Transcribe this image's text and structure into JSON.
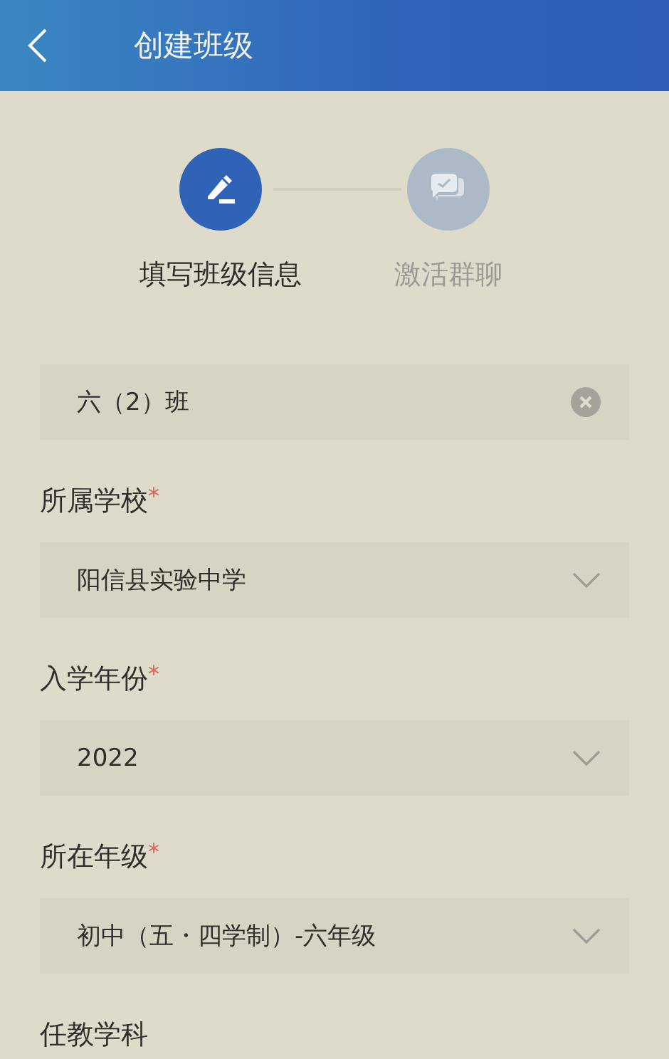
{
  "header": {
    "title": "创建班级"
  },
  "steps": [
    {
      "label": "填写班级信息",
      "selected": true
    },
    {
      "label": "激活群聊",
      "selected": false
    }
  ],
  "form": [
    {
      "kind": "text",
      "value": "六（2）班"
    },
    {
      "kind": "select",
      "label": "所属学校",
      "required_mark": "*",
      "value": "阳信县实验中学"
    },
    {
      "kind": "select",
      "label": "入学年份",
      "required_mark": "*",
      "value": "2022"
    },
    {
      "kind": "select",
      "label": "所在年级",
      "required_mark": "*",
      "value": "初中（五・四学制）-六年级"
    },
    {
      "kind": "label",
      "label": "任教学科"
    }
  ]
}
